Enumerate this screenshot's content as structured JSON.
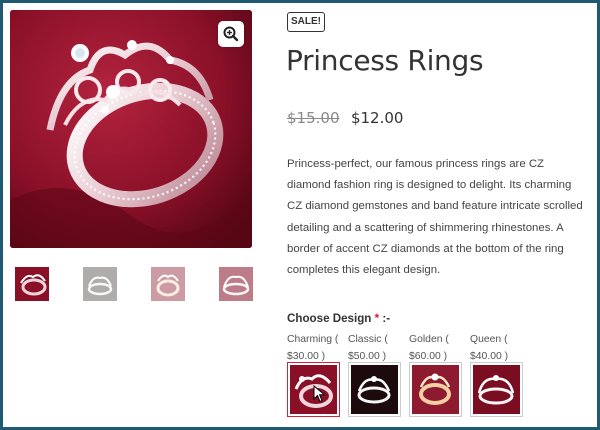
{
  "product": {
    "sale_badge": "SALE!",
    "title": "Princess Rings",
    "old_price": "$15.00",
    "new_price": "$12.00",
    "description": "Princess-perfect, our famous princess rings are CZ diamond fashion ring is designed to delight. Its charming CZ diamond gemstones and band feature intricate scrolled detailing and a scattering of shimmering rhinestones. A border of accent CZ diamonds at the bottom of the ring completes this elegant design."
  },
  "gallery": {
    "zoom_icon": "zoom-in-icon",
    "thumbnails": 4,
    "selected_thumbnail": 0
  },
  "design": {
    "label": "Choose Design",
    "required_mark": "*",
    "label_suffix": ":-",
    "options": [
      {
        "name": "Charming (",
        "price": "$30.00 )",
        "selected": true
      },
      {
        "name": "Classic (",
        "price": "$50.00 )",
        "selected": false
      },
      {
        "name": "Golden (",
        "price": "$60.00 )",
        "selected": false
      },
      {
        "name": "Queen (",
        "price": "$40.00 )",
        "selected": false
      }
    ]
  },
  "colors": {
    "accent": "#d3243c",
    "background_red": "#7d0f25",
    "frame": "#1f5a72"
  }
}
